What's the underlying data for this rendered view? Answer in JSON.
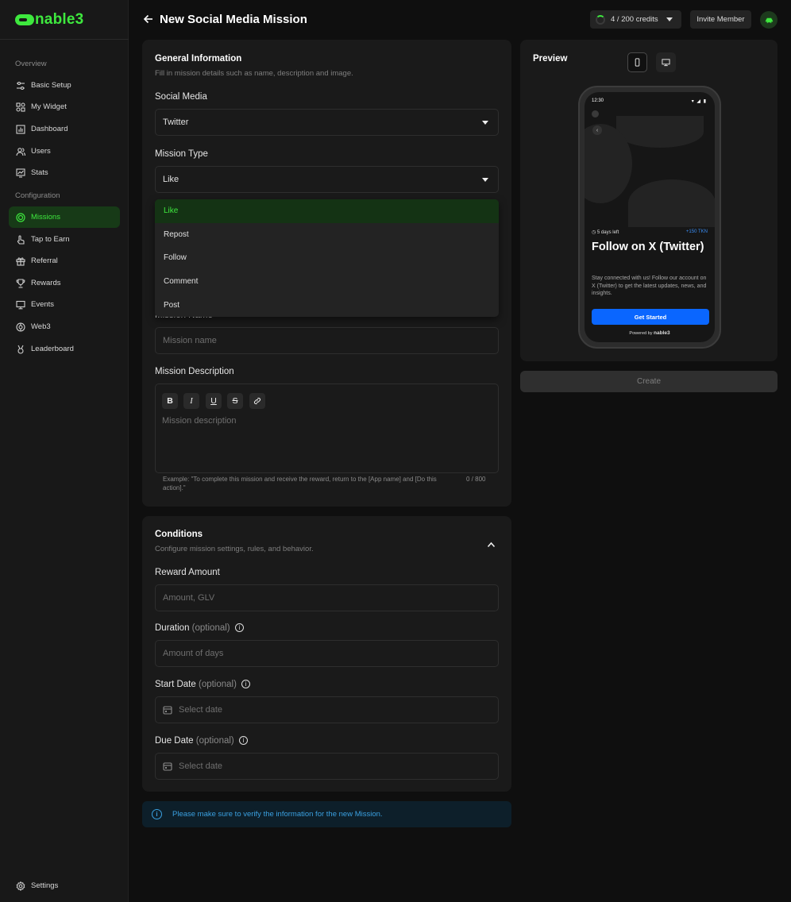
{
  "app": {
    "logo_text": "nable3"
  },
  "sidebar": {
    "sections": [
      {
        "label": "Overview"
      },
      {
        "label": "Configuration"
      }
    ],
    "items": [
      {
        "label": "Basic Setup",
        "icon": "sliders-icon"
      },
      {
        "label": "My Widget",
        "icon": "widget-icon"
      },
      {
        "label": "Dashboard",
        "icon": "bar-chart-icon"
      },
      {
        "label": "Users",
        "icon": "users-icon"
      },
      {
        "label": "Stats",
        "icon": "stats-icon"
      },
      {
        "label": "Missions",
        "icon": "target-icon",
        "active": true
      },
      {
        "label": "Tap to Earn",
        "icon": "tap-icon"
      },
      {
        "label": "Referral",
        "icon": "gift-icon"
      },
      {
        "label": "Rewards",
        "icon": "trophy-icon"
      },
      {
        "label": "Events",
        "icon": "monitor-icon"
      },
      {
        "label": "Web3",
        "icon": "web3-icon"
      },
      {
        "label": "Leaderboard",
        "icon": "medal-icon"
      }
    ],
    "settings_label": "Settings"
  },
  "header": {
    "title": "New Social Media Mission",
    "credits": "4 / 200 credits",
    "invite_label": "Invite Member"
  },
  "general": {
    "title": "General Information",
    "subtitle": "Fill in mission details such as name, description and image.",
    "social_media_label": "Social Media",
    "social_media_value": "Twitter",
    "mission_type_label": "Mission Type",
    "mission_type_value": "Like",
    "mission_type_options": [
      "Like",
      "Repost",
      "Follow",
      "Comment",
      "Post"
    ],
    "mission_name_label": "Mission Name",
    "mission_name_placeholder": "Mission name",
    "mission_desc_label": "Mission Description",
    "mission_desc_placeholder": "Mission description",
    "toolbar": {
      "bold": "B",
      "italic": "I",
      "underline": "U",
      "strike": "S"
    },
    "hint": "Example: \"To complete this mission and receive the reward, return to the [App name] and [Do this action].\"",
    "counter": "0 / 800"
  },
  "conditions": {
    "title": "Conditions",
    "subtitle": "Configure mission settings, rules, and behavior.",
    "reward_label": "Reward Amount",
    "reward_placeholder": "Amount, GLV",
    "duration_label": "Duration",
    "duration_opt": "(optional)",
    "duration_placeholder": "Amount of days",
    "start_label": "Start Date",
    "start_opt": "(optional)",
    "start_placeholder": "Select date",
    "due_label": "Due Date",
    "due_opt": "(optional)",
    "due_placeholder": "Select date"
  },
  "notice": "Please make sure to verify the information for the new Mission.",
  "preview": {
    "title": "Preview",
    "phone": {
      "time": "12:30",
      "days_left": "5 days left",
      "reward": "+150 TKN",
      "title": "Follow on X (Twitter)",
      "description": "Stay connected with us! Follow our account on X (Twitter) to get the latest updates, news, and insights.",
      "cta": "Get Started",
      "powered_by": "Powered by",
      "powered_brand": "nable3"
    },
    "create_label": "Create"
  },
  "colors": {
    "accent": "#3ee83e",
    "cta_blue": "#0a66ff",
    "info_blue": "#3aa0e0"
  }
}
